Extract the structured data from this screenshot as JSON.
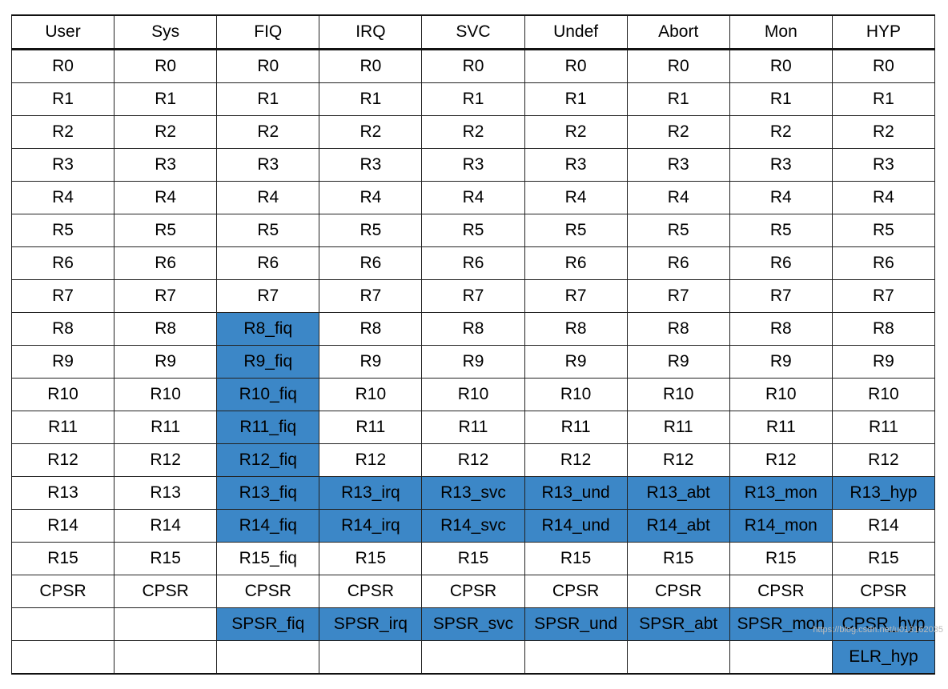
{
  "headers": [
    "User",
    "Sys",
    "FIQ",
    "IRQ",
    "SVC",
    "Undef",
    "Abort",
    "Mon",
    "HYP"
  ],
  "rows": [
    [
      {
        "t": "R0"
      },
      {
        "t": "R0"
      },
      {
        "t": "R0"
      },
      {
        "t": "R0"
      },
      {
        "t": "R0"
      },
      {
        "t": "R0"
      },
      {
        "t": "R0"
      },
      {
        "t": "R0"
      },
      {
        "t": "R0"
      }
    ],
    [
      {
        "t": "R1"
      },
      {
        "t": "R1"
      },
      {
        "t": "R1"
      },
      {
        "t": "R1"
      },
      {
        "t": "R1"
      },
      {
        "t": "R1"
      },
      {
        "t": "R1"
      },
      {
        "t": "R1"
      },
      {
        "t": "R1"
      }
    ],
    [
      {
        "t": "R2"
      },
      {
        "t": "R2"
      },
      {
        "t": "R2"
      },
      {
        "t": "R2"
      },
      {
        "t": "R2"
      },
      {
        "t": "R2"
      },
      {
        "t": "R2"
      },
      {
        "t": "R2"
      },
      {
        "t": "R2"
      }
    ],
    [
      {
        "t": "R3"
      },
      {
        "t": "R3"
      },
      {
        "t": "R3"
      },
      {
        "t": "R3"
      },
      {
        "t": "R3"
      },
      {
        "t": "R3"
      },
      {
        "t": "R3"
      },
      {
        "t": "R3"
      },
      {
        "t": "R3"
      }
    ],
    [
      {
        "t": "R4"
      },
      {
        "t": "R4"
      },
      {
        "t": "R4"
      },
      {
        "t": "R4"
      },
      {
        "t": "R4"
      },
      {
        "t": "R4"
      },
      {
        "t": "R4"
      },
      {
        "t": "R4"
      },
      {
        "t": "R4"
      }
    ],
    [
      {
        "t": "R5"
      },
      {
        "t": "R5"
      },
      {
        "t": "R5"
      },
      {
        "t": "R5"
      },
      {
        "t": "R5"
      },
      {
        "t": "R5"
      },
      {
        "t": "R5"
      },
      {
        "t": "R5"
      },
      {
        "t": "R5"
      }
    ],
    [
      {
        "t": "R6"
      },
      {
        "t": "R6"
      },
      {
        "t": "R6"
      },
      {
        "t": "R6"
      },
      {
        "t": "R6"
      },
      {
        "t": "R6"
      },
      {
        "t": "R6"
      },
      {
        "t": "R6"
      },
      {
        "t": "R6"
      }
    ],
    [
      {
        "t": "R7"
      },
      {
        "t": "R7"
      },
      {
        "t": "R7"
      },
      {
        "t": "R7"
      },
      {
        "t": "R7"
      },
      {
        "t": "R7"
      },
      {
        "t": "R7"
      },
      {
        "t": "R7"
      },
      {
        "t": "R7"
      }
    ],
    [
      {
        "t": "R8"
      },
      {
        "t": "R8"
      },
      {
        "t": "R8_fiq",
        "h": 1
      },
      {
        "t": "R8"
      },
      {
        "t": "R8"
      },
      {
        "t": "R8"
      },
      {
        "t": "R8"
      },
      {
        "t": "R8"
      },
      {
        "t": "R8"
      }
    ],
    [
      {
        "t": "R9"
      },
      {
        "t": "R9"
      },
      {
        "t": "R9_fiq",
        "h": 1
      },
      {
        "t": "R9"
      },
      {
        "t": "R9"
      },
      {
        "t": "R9"
      },
      {
        "t": "R9"
      },
      {
        "t": "R9"
      },
      {
        "t": "R9"
      }
    ],
    [
      {
        "t": "R10"
      },
      {
        "t": "R10"
      },
      {
        "t": "R10_fiq",
        "h": 1
      },
      {
        "t": "R10"
      },
      {
        "t": "R10"
      },
      {
        "t": "R10"
      },
      {
        "t": "R10"
      },
      {
        "t": "R10"
      },
      {
        "t": "R10"
      }
    ],
    [
      {
        "t": "R11"
      },
      {
        "t": "R11"
      },
      {
        "t": "R11_fiq",
        "h": 1
      },
      {
        "t": "R11"
      },
      {
        "t": "R11"
      },
      {
        "t": "R11"
      },
      {
        "t": "R11"
      },
      {
        "t": "R11"
      },
      {
        "t": "R11"
      }
    ],
    [
      {
        "t": "R12"
      },
      {
        "t": "R12"
      },
      {
        "t": "R12_fiq",
        "h": 1
      },
      {
        "t": "R12"
      },
      {
        "t": "R12"
      },
      {
        "t": "R12"
      },
      {
        "t": "R12"
      },
      {
        "t": "R12"
      },
      {
        "t": "R12"
      }
    ],
    [
      {
        "t": "R13"
      },
      {
        "t": "R13"
      },
      {
        "t": "R13_fiq",
        "h": 1
      },
      {
        "t": "R13_irq",
        "h": 1
      },
      {
        "t": "R13_svc",
        "h": 1
      },
      {
        "t": "R13_und",
        "h": 1
      },
      {
        "t": "R13_abt",
        "h": 1
      },
      {
        "t": "R13_mon",
        "h": 1
      },
      {
        "t": "R13_hyp",
        "h": 1
      }
    ],
    [
      {
        "t": "R14"
      },
      {
        "t": "R14"
      },
      {
        "t": "R14_fiq",
        "h": 1
      },
      {
        "t": "R14_irq",
        "h": 1
      },
      {
        "t": "R14_svc",
        "h": 1
      },
      {
        "t": "R14_und",
        "h": 1
      },
      {
        "t": "R14_abt",
        "h": 1
      },
      {
        "t": "R14_mon",
        "h": 1
      },
      {
        "t": "R14"
      }
    ],
    [
      {
        "t": "R15"
      },
      {
        "t": "R15"
      },
      {
        "t": "R15_fiq"
      },
      {
        "t": "R15"
      },
      {
        "t": "R15"
      },
      {
        "t": "R15"
      },
      {
        "t": "R15"
      },
      {
        "t": "R15"
      },
      {
        "t": "R15"
      }
    ],
    [
      {
        "t": "CPSR"
      },
      {
        "t": "CPSR"
      },
      {
        "t": "CPSR"
      },
      {
        "t": "CPSR"
      },
      {
        "t": "CPSR"
      },
      {
        "t": "CPSR"
      },
      {
        "t": "CPSR"
      },
      {
        "t": "CPSR"
      },
      {
        "t": "CPSR"
      }
    ],
    [
      {
        "t": ""
      },
      {
        "t": ""
      },
      {
        "t": "SPSR_fiq",
        "h": 1
      },
      {
        "t": "SPSR_irq",
        "h": 1
      },
      {
        "t": "SPSR_svc",
        "h": 1
      },
      {
        "t": "SPSR_und",
        "h": 1
      },
      {
        "t": "SPSR_abt",
        "h": 1
      },
      {
        "t": "SPSR_mon",
        "h": 1
      },
      {
        "t": "CPSR_hyp",
        "h": 1
      }
    ],
    [
      {
        "t": ""
      },
      {
        "t": ""
      },
      {
        "t": ""
      },
      {
        "t": ""
      },
      {
        "t": ""
      },
      {
        "t": ""
      },
      {
        "t": ""
      },
      {
        "t": ""
      },
      {
        "t": "ELR_hyp",
        "h": 1
      }
    ]
  ],
  "watermark": "https://blog.csdn.net/u013162035"
}
